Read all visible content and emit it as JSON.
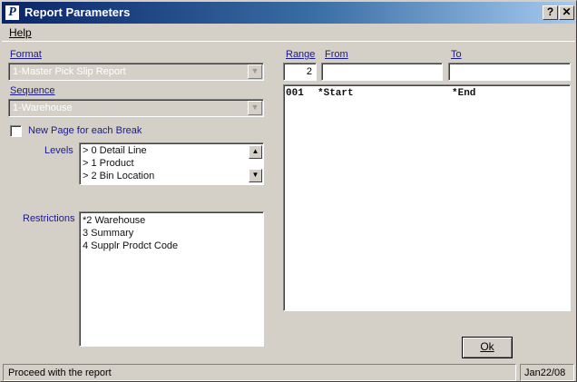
{
  "window": {
    "title": "Report Parameters",
    "help_button": "?",
    "close_button": "✕",
    "icon_glyph": "P"
  },
  "menu": {
    "help": "Help"
  },
  "format": {
    "label": "Format",
    "value": "1-Master Pick Slip Report"
  },
  "sequence": {
    "label": "Sequence",
    "value": "1-Warehouse"
  },
  "new_page_label": "New Page for each Break",
  "levels": {
    "label": "Levels",
    "items": [
      "> 0 Detail Line",
      "> 1 Product",
      "> 2 Bin Location"
    ]
  },
  "restrictions": {
    "label": "Restrictions",
    "items": [
      "*2 Warehouse",
      "3 Summary",
      "4 Supplr Prodct Code"
    ]
  },
  "range": {
    "range_label": "Range",
    "from_label": "From",
    "to_label": "To",
    "range_value": "2",
    "from_value": "",
    "to_value": "",
    "rows": [
      {
        "num": "001",
        "from": "*Start",
        "to": "*End"
      }
    ]
  },
  "ok_label": "Ok",
  "status": {
    "message": "Proceed with the report",
    "date": "Jan22/08"
  },
  "colors": {
    "title_gradient_start": "#0a246a",
    "title_gradient_end": "#a6caf0",
    "dialog_bg": "#d4d0c8",
    "label_blue": "#1a1a8c"
  }
}
